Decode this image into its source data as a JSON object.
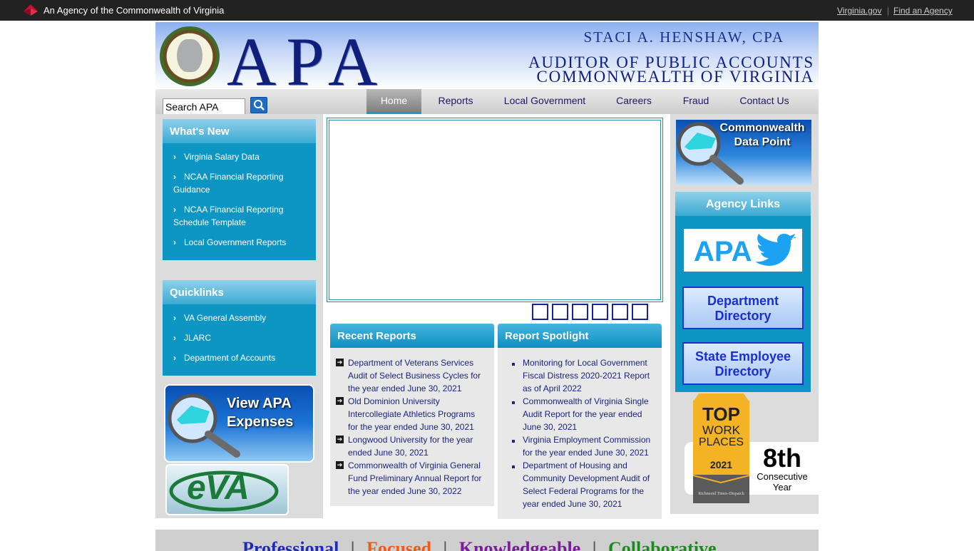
{
  "topbar": {
    "agency_text": "An Agency of the Commonwealth of Virginia",
    "links": [
      "Virginia.gov",
      "Find an Agency"
    ]
  },
  "header": {
    "logo_text": "APA",
    "auditor_name": "STACI A. HENSHAW, CPA",
    "office_line1": "AUDITOR OF PUBLIC ACCOUNTS",
    "office_line2": "COMMONWEALTH OF VIRGINIA"
  },
  "search": {
    "placeholder": "Search APA",
    "value": "Search APA"
  },
  "nav": {
    "items": [
      "Home",
      "Reports",
      "Local Government",
      "Careers",
      "Fraud",
      "Contact Us"
    ],
    "active": "Home"
  },
  "whats_new": {
    "title": "What's New",
    "items": [
      "Virginia Salary Data",
      "NCAA Financial Reporting Guidance",
      "NCAA Financial Reporting Schedule Template",
      "Local Government Reports"
    ]
  },
  "quicklinks": {
    "title": "Quicklinks",
    "items": [
      "VA General Assembly",
      "JLARC",
      "Department of Accounts"
    ]
  },
  "promo": {
    "expenses_line1": "View APA",
    "expenses_line2": "Expenses",
    "eva": "eVA"
  },
  "recent_reports": {
    "title": "Recent Reports",
    "items": [
      "Department of Veterans Services Audit of Select Business Cycles for the year ended June 30, 2021",
      "Old Dominion University Intercollegiate Athletics Programs for the year ended June 30, 2021",
      "Longwood University for the year ended June 30, 2021",
      "Commonwealth of Virginia General Fund Preliminary Annual Report for the year ended June 30, 2022"
    ]
  },
  "report_spotlight": {
    "title": "Report Spotlight",
    "items": [
      "Monitoring for Local Government Fiscal Distress 2020-2021 Report as of April 2022",
      "Commonwealth of Virginia Single Audit Report for the year ended June 30, 2021",
      "Virginia Employment Commission for the year ended June 30, 2021",
      "Department of Housing and Community Development Audit of Select Federal Programs for the year ended June 30, 2021"
    ]
  },
  "right": {
    "data_point_line1": "Commonwealth",
    "data_point_line2": "Data Point",
    "agency_links_title": "Agency Links",
    "apa_twitter": "APA",
    "dept_dir_line1": "Department",
    "dept_dir_line2": "Directory",
    "state_dir_line1": "State Employee",
    "state_dir_line2": "Directory",
    "award_top": "TOP",
    "award_work": "WORK",
    "award_places": "PLACES",
    "award_year": "2021",
    "award_source": "Richmond Times-Dispatch",
    "award_rank": "8th",
    "award_consecutive": "Consecutive",
    "award_year_word": "Year"
  },
  "footer": {
    "words": [
      "Professional",
      "|",
      "Focused",
      "|",
      "Knowledgeable",
      "|",
      "Collaborative"
    ],
    "colors": [
      "#1d2bb8",
      "#555555",
      "#f05a1a",
      "#555555",
      "#7a1c9c",
      "#555555",
      "#1c8a1c"
    ]
  },
  "colors": {
    "panel_blue": "#0d96c4",
    "nav_text": "#1a1a66",
    "link_blue": "#1a237e"
  }
}
